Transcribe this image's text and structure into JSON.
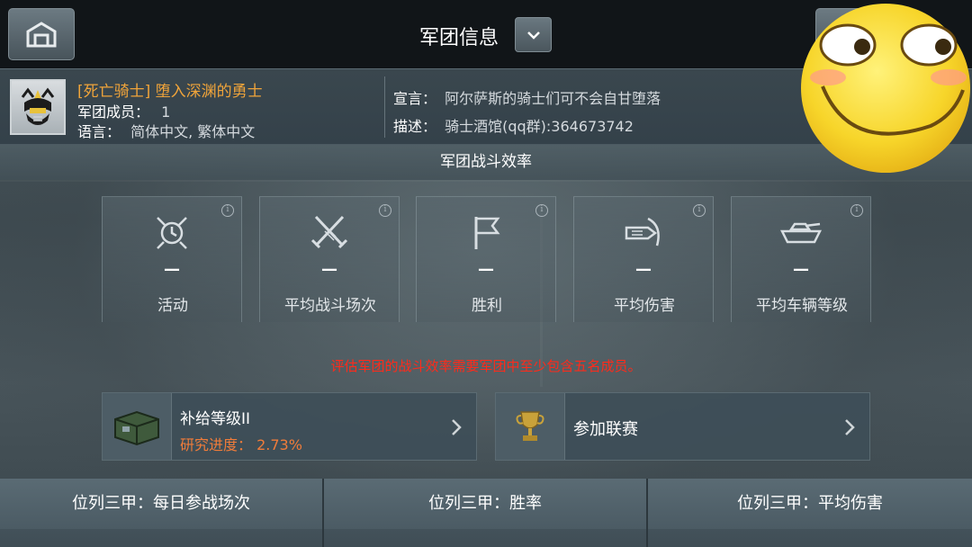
{
  "header": {
    "title": "军团信息"
  },
  "clan": {
    "name": "[死亡骑士] 堕入深渊的勇士",
    "members_label": "军团成员：",
    "members_value": "1",
    "language_label": "语言：",
    "language_value": "简体中文, 繁体中文",
    "motto_label": "宣言：",
    "motto_value": "阿尔萨斯的骑士们可不会自甘堕落",
    "description_label": "描述：",
    "description_value": "骑士酒馆(qq群):364673742"
  },
  "efficiency": {
    "section_title": "军团战斗效率",
    "stats": [
      {
        "icon": "activity-icon",
        "value": "—",
        "label": "活动"
      },
      {
        "icon": "crossed-swords-icon",
        "value": "—",
        "label": "平均战斗场次"
      },
      {
        "icon": "flag-icon",
        "value": "—",
        "label": "胜利"
      },
      {
        "icon": "shell-damage-icon",
        "value": "—",
        "label": "平均伤害"
      },
      {
        "icon": "tank-icon",
        "value": "—",
        "label": "平均车辆等级"
      }
    ],
    "warning": "评估军团的战斗效率需要军团中至少包含五名成员。"
  },
  "supply": {
    "label": "补给等级II",
    "progress": "研究进度： 2.73%",
    "icon": "supply-crate-icon"
  },
  "league": {
    "label": "参加联赛",
    "icon": "trophy-icon"
  },
  "bottom_tabs": [
    {
      "label": "位列三甲：每日参战场次"
    },
    {
      "label": "位列三甲：胜率"
    },
    {
      "label": "位列三甲：平均伤害"
    }
  ],
  "colors": {
    "clan_name": "#f0a43a",
    "warning": "#ff2a1a",
    "progress": "#f07c3a"
  }
}
